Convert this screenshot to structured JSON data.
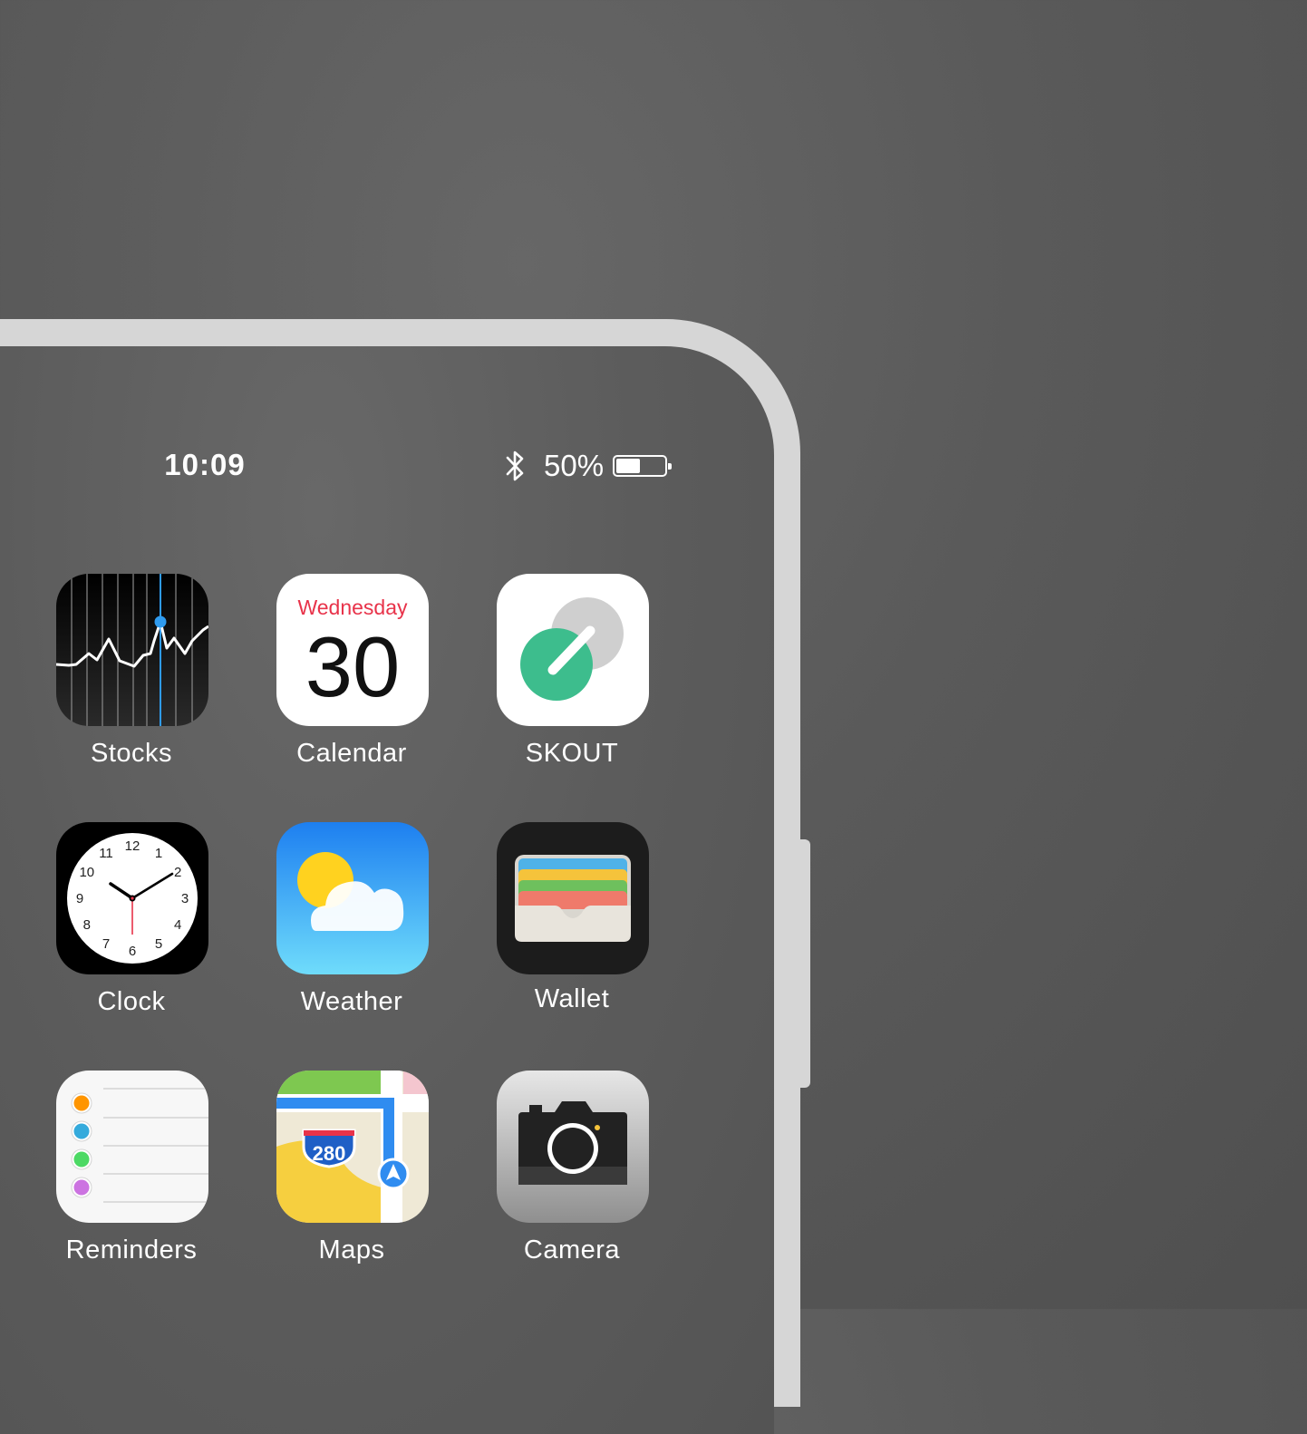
{
  "status_bar": {
    "time": "10:09",
    "bluetooth_icon": "bluetooth-icon",
    "battery_percent": "50%",
    "battery_level": 0.5
  },
  "apps": [
    {
      "label": "Stocks",
      "icon": "stocks-icon"
    },
    {
      "label": "Calendar",
      "icon": "calendar-icon",
      "weekday": "Wednesday",
      "day": "30"
    },
    {
      "label": "SKOUT",
      "icon": "skout-icon"
    },
    {
      "label": "Clock",
      "icon": "clock-icon",
      "numerals": [
        "12",
        "1",
        "2",
        "3",
        "4",
        "5",
        "6",
        "7",
        "8",
        "9",
        "10",
        "11"
      ]
    },
    {
      "label": "Weather",
      "icon": "weather-icon"
    },
    {
      "label": "Wallet",
      "icon": "wallet-icon"
    },
    {
      "label": "Reminders",
      "icon": "reminders-icon"
    },
    {
      "label": "Maps",
      "icon": "maps-icon",
      "shield": "280"
    },
    {
      "label": "Camera",
      "icon": "camera-icon"
    }
  ],
  "colors": {
    "background": "#5a5a5a",
    "frame": "#d6d6d6",
    "calendar_red": "#e8334a",
    "skout_green": "#3dbd8d",
    "stocks_blue": "#2f9bef"
  }
}
